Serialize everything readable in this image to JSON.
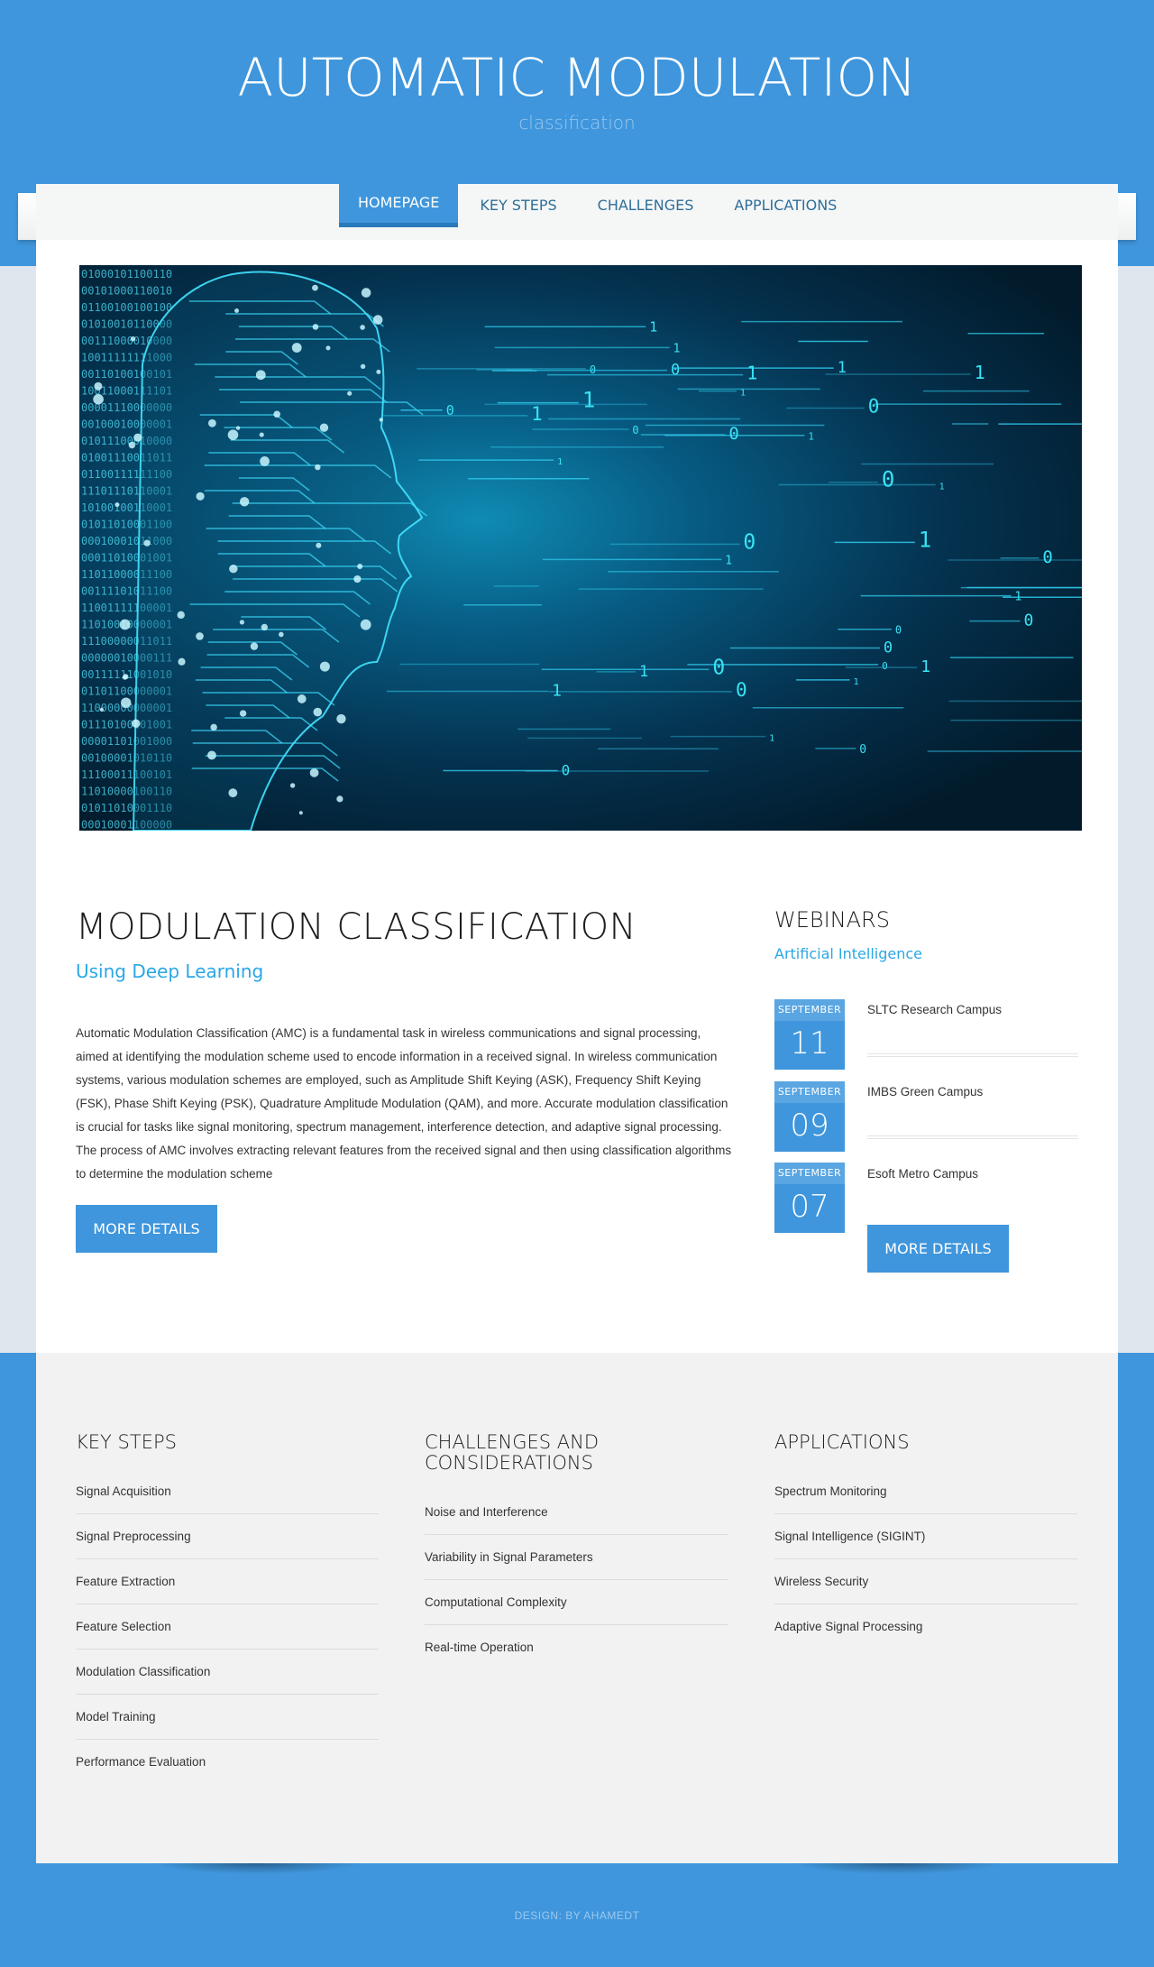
{
  "header": {
    "title": "AUTOMATIC MODULATION",
    "subtitle": "classification"
  },
  "nav": {
    "items": [
      {
        "label": "HOMEPAGE",
        "active": true
      },
      {
        "label": "KEY STEPS",
        "active": false
      },
      {
        "label": "CHALLENGES",
        "active": false
      },
      {
        "label": "APPLICATIONS",
        "active": false
      }
    ]
  },
  "hero": {
    "icon": "ai-head-circuit-image"
  },
  "main": {
    "title": "MODULATION CLASSIFICATION",
    "subtitle": "Using Deep Learning",
    "body": "Automatic Modulation Classification (AMC) is a fundamental task in wireless communications and signal processing, aimed at identifying the modulation scheme used to encode information in a received signal. In wireless communication systems, various modulation schemes are employed, such as Amplitude Shift Keying (ASK), Frequency Shift Keying (FSK), Phase Shift Keying (PSK), Quadrature Amplitude Modulation (QAM), and more. Accurate modulation classification is crucial for tasks like signal monitoring, spectrum management, interference detection, and adaptive signal processing. The process of AMC involves extracting relevant features from the received signal and then using classification algorithms to determine the modulation scheme",
    "button": "MORE DETAILS"
  },
  "webinars": {
    "title": "WEBINARS",
    "subtitle": "Artificial Intelligence",
    "events": [
      {
        "month": "SEPTEMBER",
        "day": "11",
        "venue": "SLTC Research Campus"
      },
      {
        "month": "SEPTEMBER",
        "day": "09",
        "venue": "IMBS Green Campus"
      },
      {
        "month": "SEPTEMBER",
        "day": "07",
        "venue": "Esoft Metro Campus"
      }
    ],
    "button": "MORE DETAILS"
  },
  "footer": {
    "key_steps": {
      "title": "KEY STEPS",
      "items": [
        "Signal Acquisition",
        "Signal Preprocessing",
        "Feature Extraction",
        "Feature Selection",
        "Modulation Classification",
        "Model Training",
        "Performance Evaluation"
      ]
    },
    "challenges": {
      "title_line1": "CHALLENGES AND",
      "title_line2": "CONSIDERATIONS",
      "items": [
        "Noise and Interference",
        "Variability in Signal Parameters",
        "Computational Complexity",
        "Real-time Operation"
      ]
    },
    "applications": {
      "title": "APPLICATIONS",
      "items": [
        "Spectrum Monitoring",
        "Signal Intelligence (SIGINT)",
        "Wireless Security",
        "Adaptive Signal Processing"
      ]
    },
    "credit": "DESIGN: BY AHAMEDT"
  },
  "colors": {
    "brand_blue": "#3f96dc",
    "accent_cyan": "#2aa7e4"
  }
}
